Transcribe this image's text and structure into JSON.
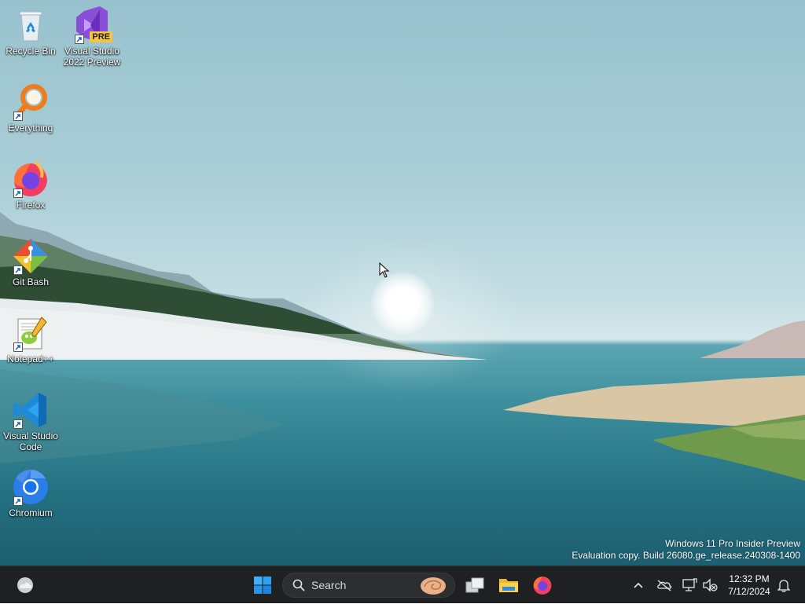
{
  "desktop": {
    "icons": [
      {
        "label": "Recycle Bin",
        "icon": "recycle-bin-icon",
        "shortcut": false
      },
      {
        "label": "Visual Studio 2022 Preview",
        "icon": "visual-studio-preview-icon",
        "badge": "PRE",
        "shortcut": true
      },
      {
        "label": "Everything",
        "icon": "everything-search-icon",
        "shortcut": true
      },
      {
        "label": "Firefox",
        "icon": "firefox-icon",
        "shortcut": true
      },
      {
        "label": "Git Bash",
        "icon": "git-bash-icon",
        "shortcut": true
      },
      {
        "label": "Notepad++",
        "icon": "notepad-plus-plus-icon",
        "shortcut": true
      },
      {
        "label": "Visual Studio Code",
        "icon": "vscode-icon",
        "shortcut": true
      },
      {
        "label": "Chromium",
        "icon": "chromium-icon",
        "shortcut": true
      }
    ],
    "watermark": {
      "line1": "Windows 11 Pro Insider Preview",
      "line2": "Evaluation copy. Build 26080.ge_release.240308-1400"
    }
  },
  "taskbar": {
    "widgets_icon": "weather-widget-icon",
    "start_icon": "windows-start-icon",
    "search": {
      "placeholder": "Search"
    },
    "pinned": [
      {
        "name": "task-view",
        "icon": "task-view-icon"
      },
      {
        "name": "file-explorer",
        "icon": "folder-icon"
      },
      {
        "name": "firefox",
        "icon": "firefox-icon"
      }
    ],
    "tray": {
      "time": "12:32 PM",
      "date": "7/12/2024"
    }
  },
  "colors": {
    "taskbar_bg": "#1f2022",
    "accent": "#0a84d6"
  }
}
